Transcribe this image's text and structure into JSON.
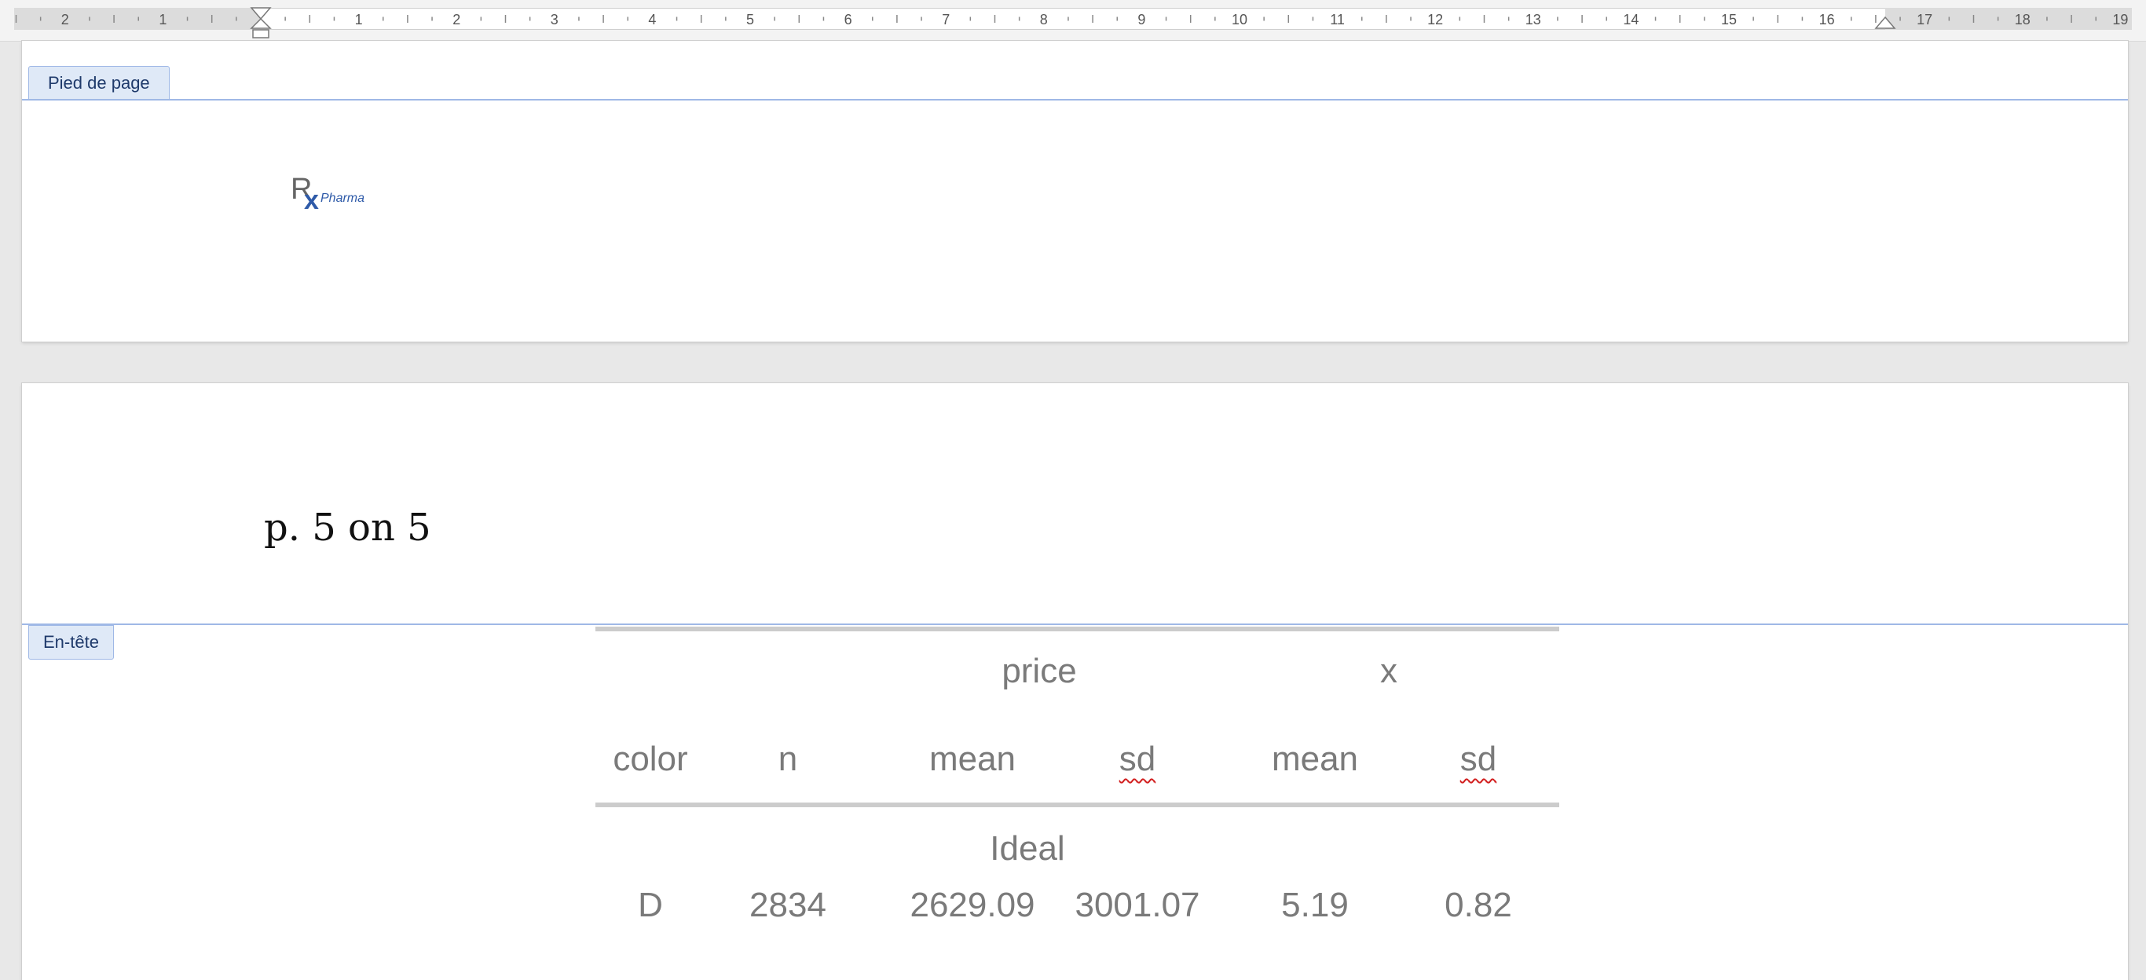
{
  "ruler": {
    "numbers": [
      "2",
      "1",
      "1",
      "2",
      "3",
      "4",
      "5",
      "6",
      "7",
      "8",
      "9",
      "10",
      "11",
      "12",
      "13",
      "14",
      "15",
      "16",
      "17",
      "18",
      "19"
    ]
  },
  "footer": {
    "tag": "Pied de page",
    "logo": {
      "r": "R",
      "x": "x",
      "sub": "Pharma"
    }
  },
  "header": {
    "tag": "En-tête",
    "page_number": "p. 5 on 5"
  },
  "table": {
    "group_headers": {
      "price": "price",
      "x": "x"
    },
    "columns": [
      "color",
      "n",
      "mean",
      "sd",
      "mean",
      "sd"
    ],
    "group_label": "Ideal",
    "rows": [
      [
        "D",
        "2834",
        "2629.09",
        "3001.07",
        "5.19",
        "0.82"
      ]
    ]
  },
  "colors": {
    "tag_bg": "#dfe9f7",
    "tag_border": "#9fb8e6",
    "table_text": "#7a7a7a",
    "logo_blue": "#2e5aa8"
  }
}
